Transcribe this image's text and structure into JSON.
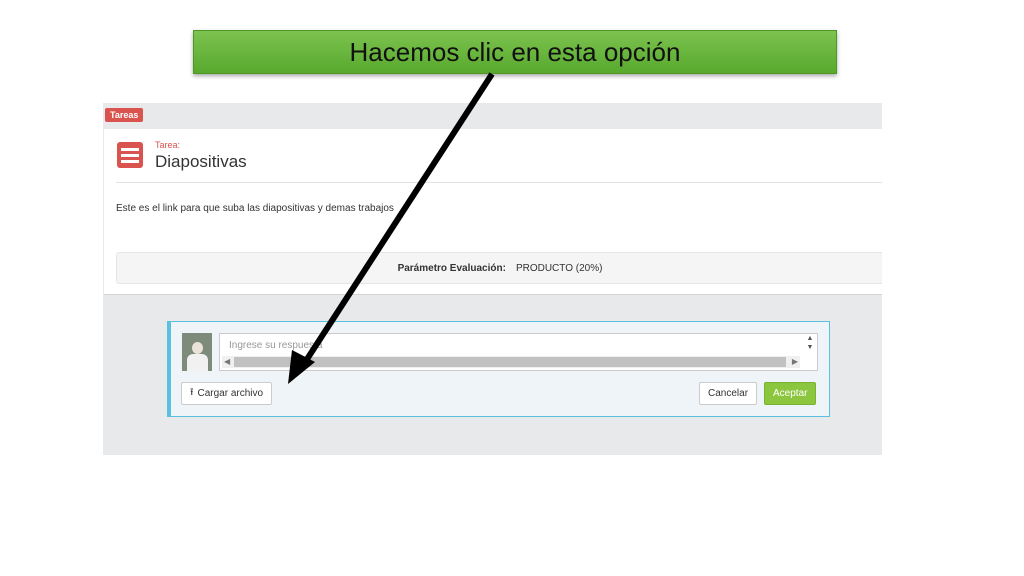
{
  "annotation": {
    "banner_text": "Hacemos clic en esta opción"
  },
  "app": {
    "tag": "Tareas",
    "task_label": "Tarea:",
    "task_title": "Diapositivas",
    "description": "Este es el link para que suba las diapositivas y demas trabajos",
    "parameter": {
      "label": "Parámetro Evaluación:",
      "value": "PRODUCTO (20%)"
    }
  },
  "reply": {
    "placeholder": "Ingrese su respuesta",
    "upload_label": "Cargar archivo",
    "cancel_label": "Cancelar",
    "accept_label": "Aceptar"
  },
  "colors": {
    "accent": "#5bc0de",
    "accept": "#8cc63e",
    "tag": "#d9534f",
    "banner": "#6ab83f"
  },
  "icons": {
    "task": "task-list-icon",
    "upload": "upload-icon"
  }
}
